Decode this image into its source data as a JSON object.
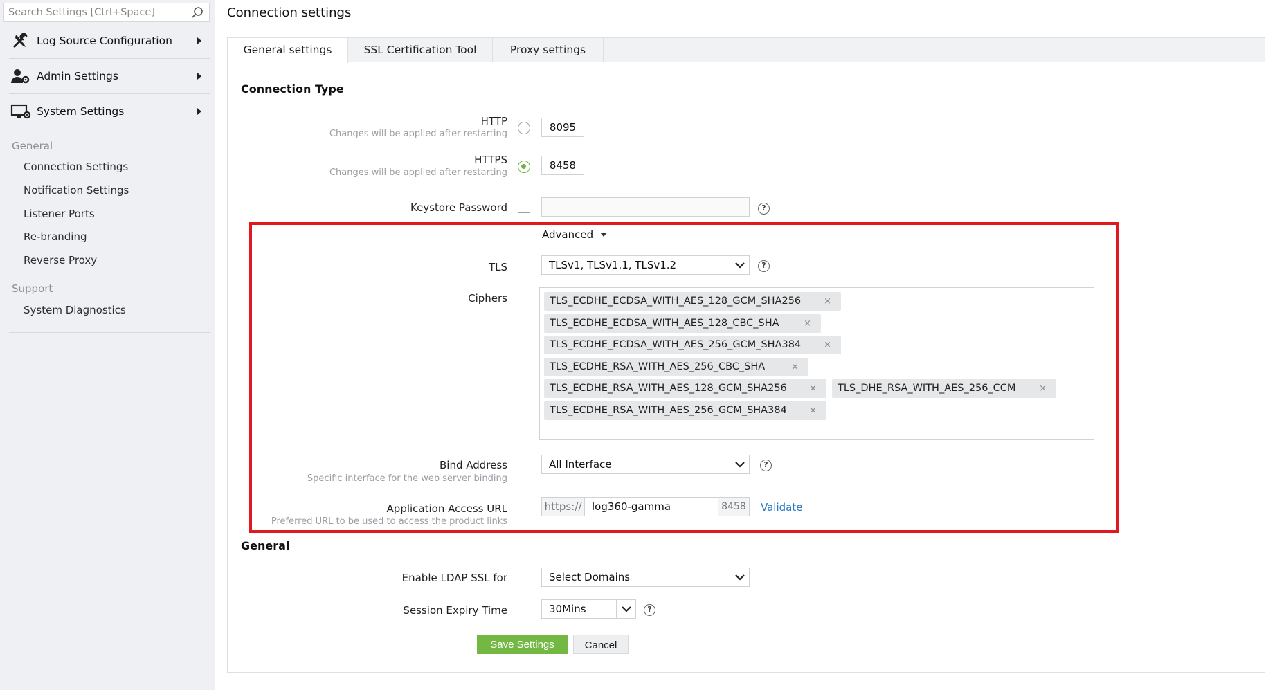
{
  "sidebar": {
    "search_placeholder": "Search Settings [Ctrl+Space]",
    "sections": [
      {
        "label": "Log Source Configuration",
        "icon": "tools-icon"
      },
      {
        "label": "Admin Settings",
        "icon": "user-gear-icon"
      },
      {
        "label": "System Settings",
        "icon": "monitor-gear-icon"
      }
    ],
    "groups": {
      "general": {
        "title": "General",
        "links": [
          "Connection Settings",
          "Notification Settings",
          "Listener Ports",
          "Re-branding",
          "Reverse Proxy"
        ]
      },
      "support": {
        "title": "Support",
        "links": [
          "System Diagnostics"
        ]
      }
    }
  },
  "main": {
    "title": "Connection settings",
    "tabs": [
      {
        "label": "General settings",
        "active": true
      },
      {
        "label": "SSL Certification Tool",
        "active": false
      },
      {
        "label": "Proxy settings",
        "active": false
      }
    ],
    "connection_type": {
      "heading": "Connection Type",
      "http": {
        "label": "HTTP",
        "hint": "Changes will be applied after restarting",
        "port": "8095",
        "selected": false
      },
      "https": {
        "label": "HTTPS",
        "hint": "Changes will be applied after restarting",
        "port": "8458",
        "selected": true
      },
      "keystore": {
        "label": "Keystore Password",
        "checked": false,
        "value": ""
      }
    },
    "advanced": {
      "toggle_label": "Advanced",
      "tls": {
        "label": "TLS",
        "value": "TLSv1, TLSv1.1, TLSv1.2"
      },
      "ciphers": {
        "label": "Ciphers",
        "chips": [
          "TLS_ECDHE_ECDSA_WITH_AES_128_GCM_SHA256",
          "TLS_ECDHE_ECDSA_WITH_AES_128_CBC_SHA",
          "TLS_ECDHE_ECDSA_WITH_AES_256_GCM_SHA384",
          "TLS_ECDHE_RSA_WITH_AES_256_CBC_SHA",
          "TLS_ECDHE_RSA_WITH_AES_128_GCM_SHA256",
          "TLS_DHE_RSA_WITH_AES_256_CCM",
          "TLS_ECDHE_RSA_WITH_AES_256_GCM_SHA384"
        ],
        "remove_glyph": "×"
      },
      "bind_address": {
        "label": "Bind Address",
        "hint": "Specific interface for the web server binding",
        "value": "All Interface"
      },
      "access_url": {
        "label": "Application Access URL",
        "hint": "Preferred URL to be used to access the product links",
        "scheme": "https://",
        "host": "log360-gamma",
        "port": "8458",
        "validate_label": "Validate"
      }
    },
    "general": {
      "heading": "General",
      "ldap_ssl": {
        "label": "Enable LDAP SSL for",
        "value": "Select Domains"
      },
      "session_expiry": {
        "label": "Session Expiry Time",
        "value": "30Mins"
      }
    },
    "buttons": {
      "save": "Save Settings",
      "cancel": "Cancel"
    },
    "help_glyph": "?"
  },
  "colors": {
    "accent_green": "#72b842",
    "highlight_red": "#e0181f",
    "link_blue": "#2878c8",
    "sidebar_bg": "#eef0f3"
  }
}
